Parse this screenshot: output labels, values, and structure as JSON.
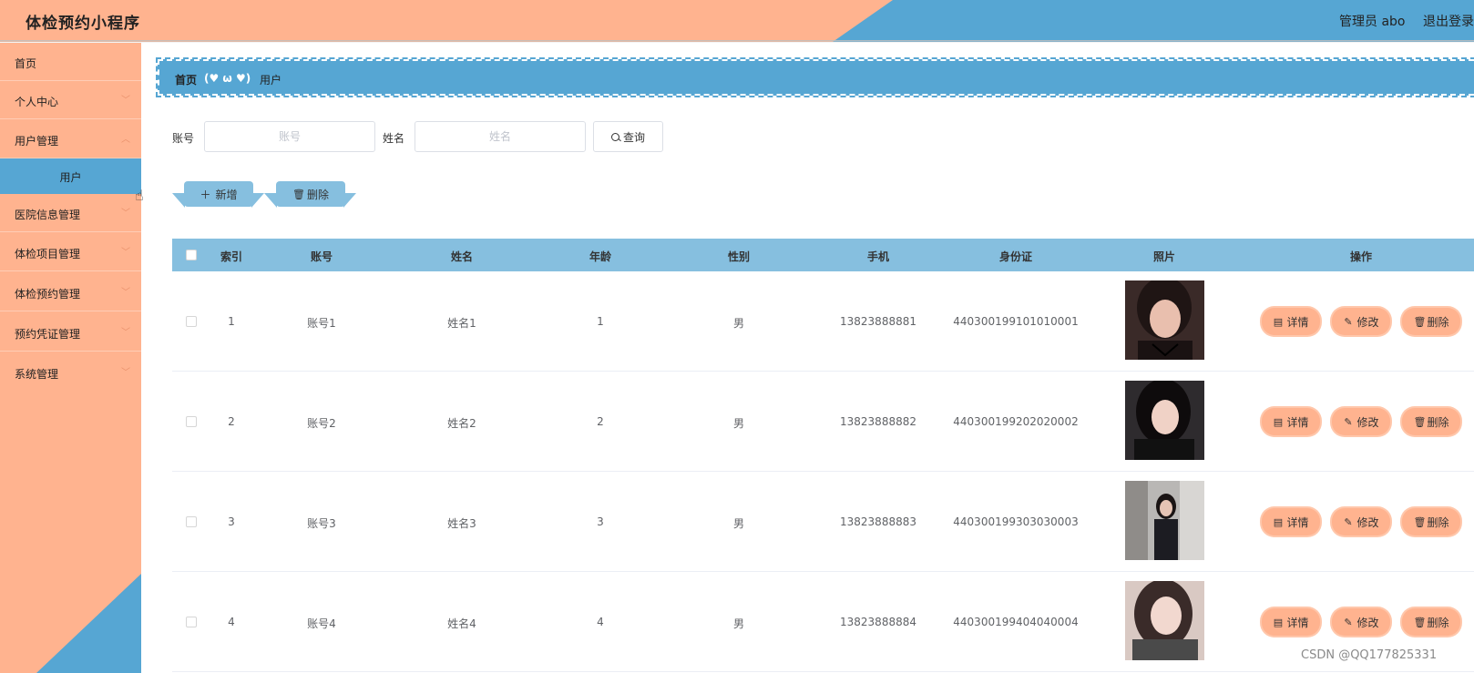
{
  "header": {
    "app_title": "体检预约小程序",
    "user_label": "管理员 abo",
    "logout_label": "退出登录"
  },
  "sidebar": {
    "items": [
      {
        "label": "首页",
        "has_submenu": false
      },
      {
        "label": "个人中心",
        "has_submenu": true
      },
      {
        "label": "用户管理",
        "has_submenu": true
      },
      {
        "label": "用户",
        "active": true
      },
      {
        "label": "医院信息管理",
        "has_submenu": true
      },
      {
        "label": "体检项目管理",
        "has_submenu": true
      },
      {
        "label": "体检预约管理",
        "has_submenu": true
      },
      {
        "label": "预约凭证管理",
        "has_submenu": true
      },
      {
        "label": "系统管理",
        "has_submenu": true
      }
    ]
  },
  "breadcrumb": {
    "home": "首页",
    "separator": "(♥ ω ♥)",
    "current": "用户"
  },
  "search": {
    "account_label": "账号",
    "account_placeholder": "账号",
    "name_label": "姓名",
    "name_placeholder": "姓名",
    "query_label": "查询"
  },
  "actions": {
    "add_label": "新增",
    "delete_label": "删除"
  },
  "table": {
    "columns": [
      "索引",
      "账号",
      "姓名",
      "年龄",
      "性别",
      "手机",
      "身份证",
      "照片",
      "操作"
    ],
    "rows": [
      {
        "index": "1",
        "account": "账号1",
        "name": "姓名1",
        "age": "1",
        "gender": "男",
        "phone": "13823888881",
        "id_card": "440300199101010001"
      },
      {
        "index": "2",
        "account": "账号2",
        "name": "姓名2",
        "age": "2",
        "gender": "男",
        "phone": "13823888882",
        "id_card": "440300199202020002"
      },
      {
        "index": "3",
        "account": "账号3",
        "name": "姓名3",
        "age": "3",
        "gender": "男",
        "phone": "13823888883",
        "id_card": "440300199303030003"
      },
      {
        "index": "4",
        "account": "账号4",
        "name": "姓名4",
        "age": "4",
        "gender": "男",
        "phone": "13823888884",
        "id_card": "440300199404040004"
      }
    ],
    "row_actions": {
      "detail": "详情",
      "edit": "修改",
      "delete": "删除"
    }
  },
  "watermark": "CSDN @QQ177825331",
  "colors": {
    "accent_orange": "#ffb38f",
    "accent_blue": "#56a6d3",
    "table_header": "#86bfdf"
  }
}
